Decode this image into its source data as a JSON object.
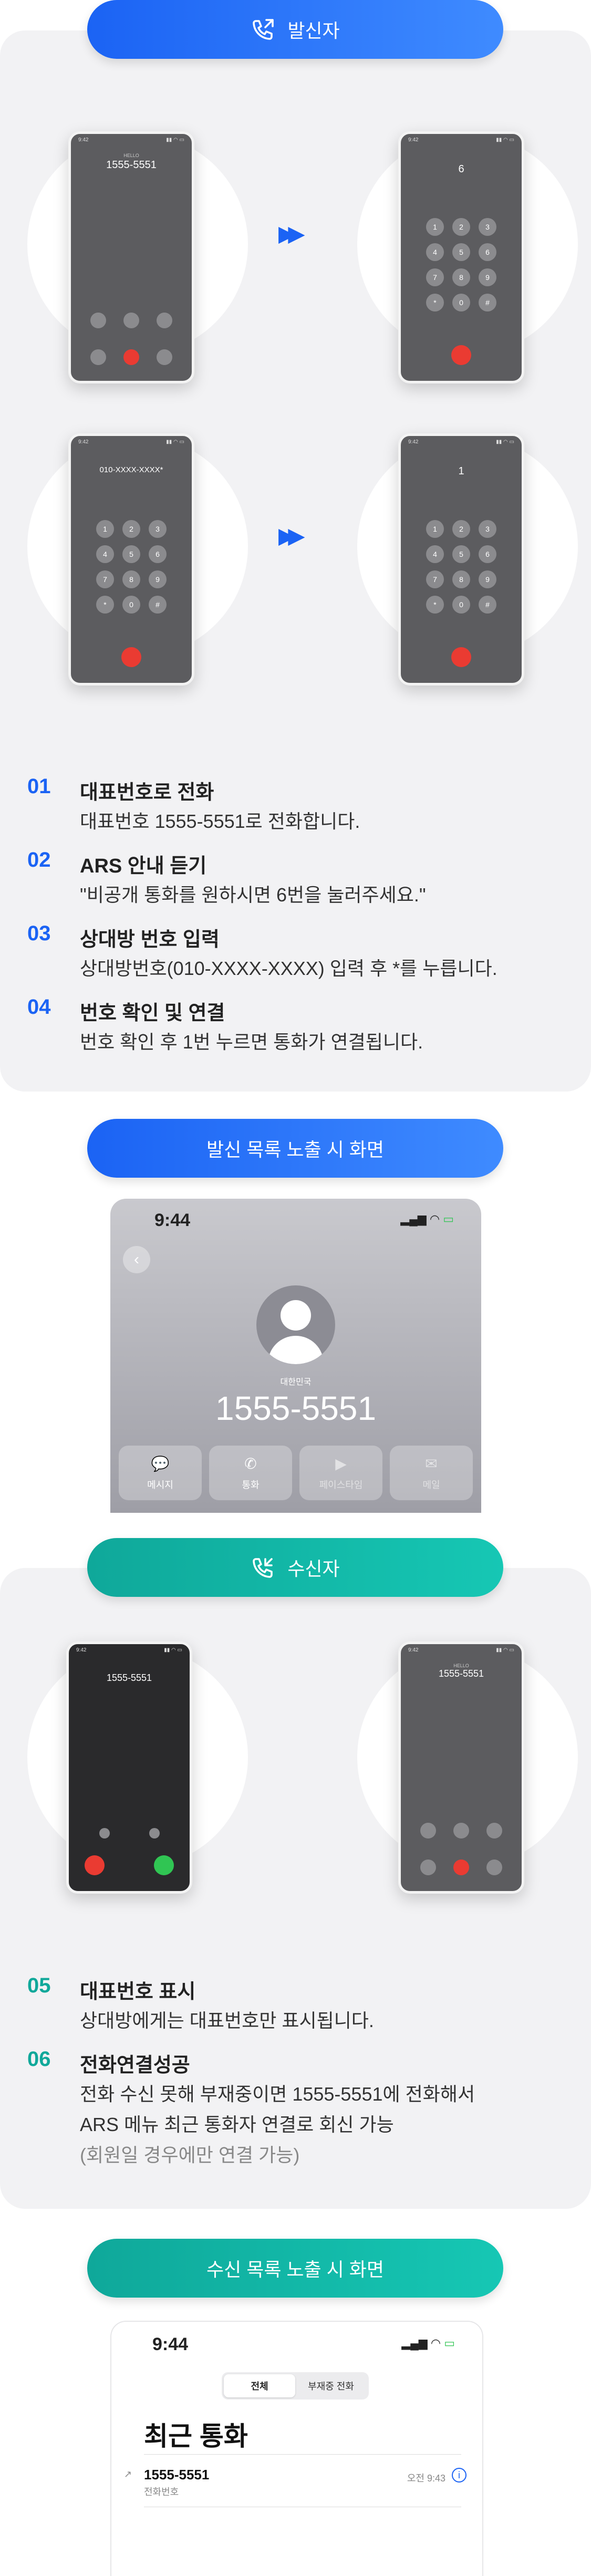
{
  "caller_section": {
    "title": "발신자",
    "phones": [
      {
        "name": "incoming-display",
        "sub": "HELLO",
        "number": "1555-5551",
        "time": "9:42"
      },
      {
        "name": "keypad-6",
        "typed": "6",
        "time": "9:42"
      },
      {
        "name": "keypad-number",
        "typed": "010-XXXX-XXXX*",
        "time": "9:42"
      },
      {
        "name": "keypad-1",
        "typed": "1",
        "time": "9:42"
      }
    ],
    "keys": [
      "1",
      "2",
      "3",
      "4",
      "5",
      "6",
      "7",
      "8",
      "9",
      "*",
      "0",
      "#"
    ],
    "steps": [
      {
        "num": "01",
        "title": "대표번호로 전화",
        "desc": "대표번호 1555-5551로 전화합니다."
      },
      {
        "num": "02",
        "title": "ARS 안내 듣기",
        "desc": "\"비공개 통화를 원하시면 6번을 눌러주세요.\""
      },
      {
        "num": "03",
        "title": "상대방 번호 입력",
        "desc": "상대방번호(010-XXXX-XXXX) 입력 후 *를 누릅니다."
      },
      {
        "num": "04",
        "title": "번호 확인 및 연결",
        "desc": "번호 확인 후 1번 누르면 통화가 연결됩니다."
      }
    ]
  },
  "caller_list": {
    "title": "발신 목록 노출 시 화면",
    "time": "9:44",
    "country": "대한민국",
    "number": "1555-5551",
    "actions": [
      "메시지",
      "통화",
      "페이스타임",
      "메일"
    ]
  },
  "receiver_section": {
    "title": "수신자",
    "phones": [
      {
        "name": "incoming-ring",
        "number": "1555-5551",
        "time": "9:42"
      },
      {
        "name": "in-call",
        "sub": "HELLO",
        "number": "1555-5551",
        "time": "9:42"
      }
    ],
    "steps": [
      {
        "num": "05",
        "title": "대표번호 표시",
        "desc": "상대방에게는 대표번호만 표시됩니다."
      },
      {
        "num": "06",
        "title": "전화연결성공",
        "desc1": "전화 수신 못해 부재중이면 1555-5551에 전화해서",
        "desc2": "ARS 메뉴 최근 통화자 연결로 회신 가능",
        "desc3": "(회원일 경우에만 연결 가능)"
      }
    ]
  },
  "receiver_list": {
    "title": "수신 목록 노출 시 화면",
    "time": "9:44",
    "tabs": [
      "전체",
      "부재중 전화"
    ],
    "heading": "최근 통화",
    "entry": {
      "number": "1555-5551",
      "label": "전화번호",
      "time": "오전 9:43"
    }
  },
  "colors": {
    "blue": "#1b63f4",
    "teal": "#10a89a",
    "end_call": "#ea3b32",
    "accept": "#30c553"
  }
}
